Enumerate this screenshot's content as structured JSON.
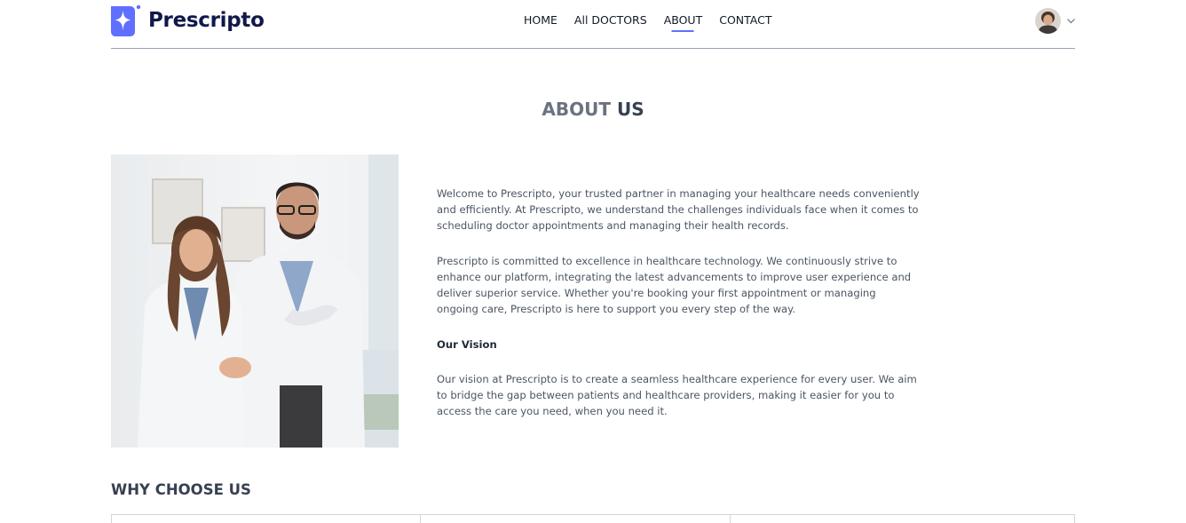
{
  "brand": {
    "name": "Prescripto",
    "accent": "#5f6fff",
    "dark": "#10184a"
  },
  "nav": {
    "items": [
      {
        "label": "HOME",
        "active": false
      },
      {
        "label": "All DOCTORS",
        "active": false
      },
      {
        "label": "ABOUT",
        "active": true
      },
      {
        "label": "CONTACT",
        "active": false
      }
    ]
  },
  "profile": {
    "avatar_icon": "user-avatar",
    "menu_icon": "chevron-down-icon"
  },
  "about": {
    "title_light": "ABOUT",
    "title_strong": "US",
    "image_alt": "Two doctors in white coats smiling",
    "paragraph_1": "Welcome to Prescripto, your trusted partner in managing your healthcare needs conveniently and efficiently. At Prescripto, we understand the challenges individuals face when it comes to scheduling doctor appointments and managing their health records.",
    "paragraph_2": "Prescripto is committed to excellence in healthcare technology. We continuously strive to enhance our platform, integrating the latest advancements to improve user experience and deliver superior service. Whether you're booking your first appointment or managing ongoing care, Prescripto is here to support you every step of the way.",
    "vision_heading": "Our Vision",
    "vision_text": "Our vision at Prescripto is to create a seamless healthcare experience for every user. We aim to bridge the gap between patients and healthcare providers, making it easier for you to access the care you need, when you need it."
  },
  "why": {
    "title_light": "WHY",
    "title_strong": "CHOOSE US"
  }
}
